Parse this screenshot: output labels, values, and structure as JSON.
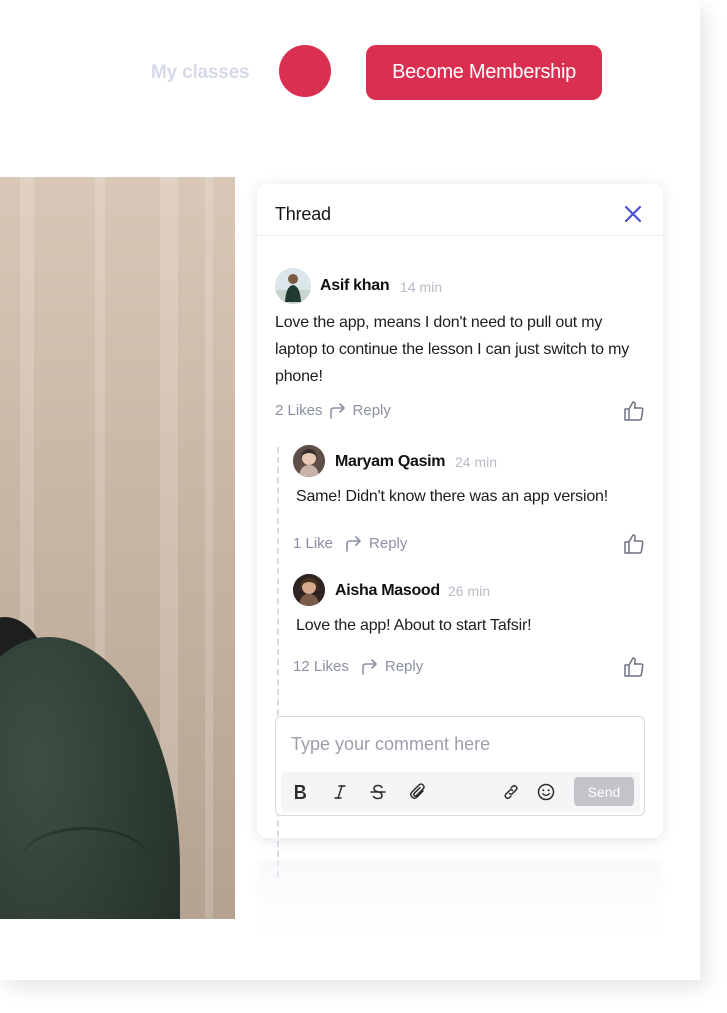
{
  "nav": {
    "my_classes": "My classes",
    "membership_button": "Become Membership",
    "accent_color": "#d92f50"
  },
  "thread": {
    "title": "Thread",
    "close_icon": "close-icon",
    "comments": [
      {
        "author": "Asif khan",
        "time": "14 min",
        "text": " Love the app, means I don't need to pull out my laptop to continue the lesson I can just switch to my phone!",
        "likes": "2 Likes",
        "reply": "Reply"
      }
    ],
    "replies": [
      {
        "author": "Maryam Qasim",
        "time": "24 min",
        "text": "Same! Didn't know there was an app version!",
        "likes": "1 Like",
        "reply": "Reply"
      },
      {
        "author": "Aisha Masood",
        "time": "26 min",
        "text": "Love the app! About to start Tafsir!",
        "likes": "12 Likes",
        "reply": "Reply"
      }
    ],
    "composer": {
      "placeholder": "Type your comment here",
      "send_label": "Send",
      "tools": [
        "bold-icon",
        "italic-icon",
        "strikethrough-icon",
        "attachment-icon",
        "link-icon",
        "emoji-icon"
      ]
    }
  }
}
